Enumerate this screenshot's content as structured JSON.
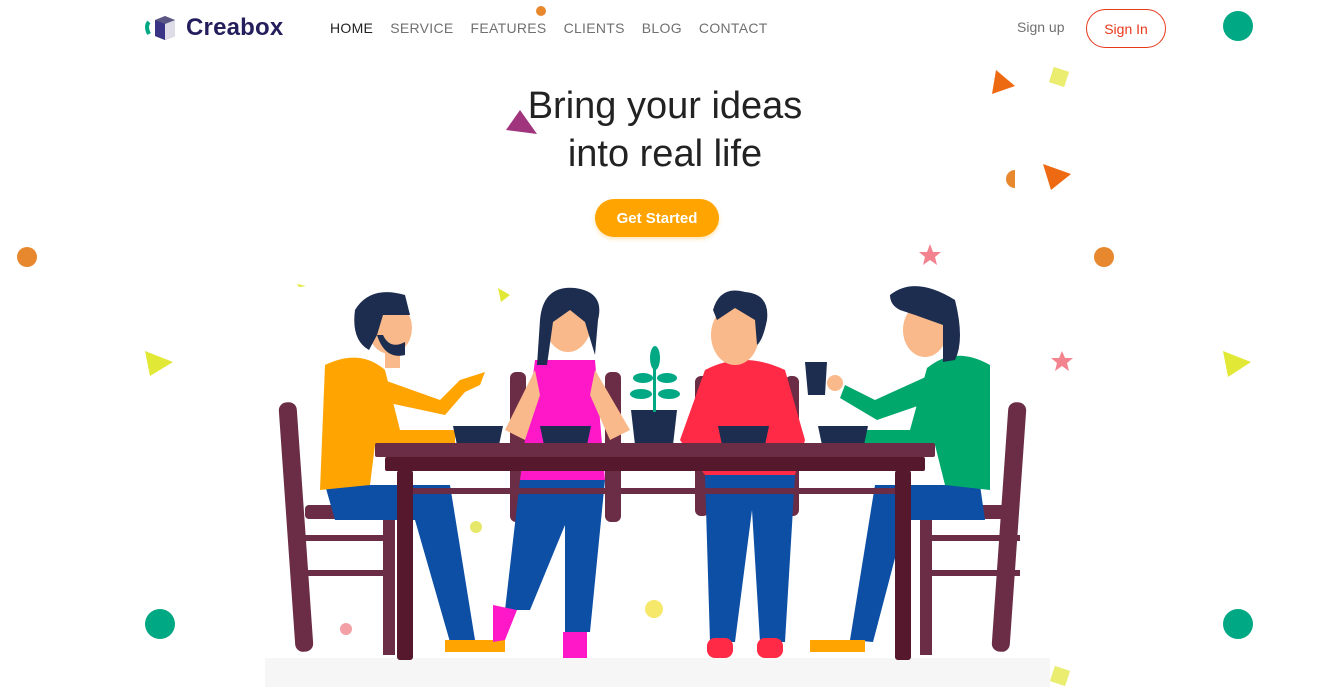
{
  "brand": {
    "name": "Creabox"
  },
  "nav": {
    "items": [
      {
        "label": "HOME",
        "active": true
      },
      {
        "label": "SERVICE",
        "active": false
      },
      {
        "label": "FEATURES",
        "active": false
      },
      {
        "label": "CLIENTS",
        "active": false
      },
      {
        "label": "BLOG",
        "active": false
      },
      {
        "label": "CONTACT",
        "active": false
      }
    ]
  },
  "auth": {
    "signup_label": "Sign up",
    "signin_label": "Sign In"
  },
  "hero": {
    "title_line1": "Bring your ideas",
    "title_line2": "into real life",
    "cta_label": "Get Started"
  },
  "colors": {
    "brand": "#241f5c",
    "accent": "#ffa400",
    "signin": "#e8381a",
    "teal": "#00a884",
    "orange": "#e8882e"
  },
  "icons": [
    "logo-cube-icon"
  ]
}
